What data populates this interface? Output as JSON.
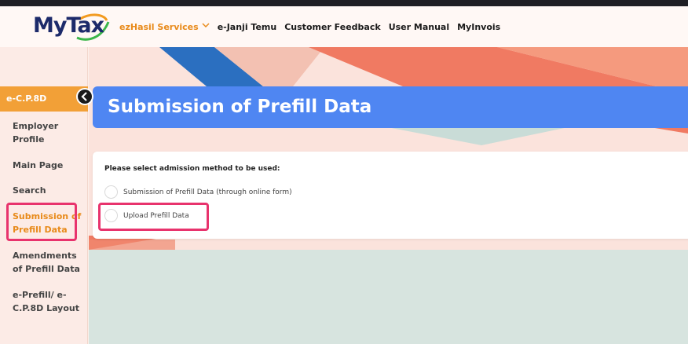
{
  "logo": {
    "my": "My",
    "tax": "Tax"
  },
  "nav": {
    "items": [
      {
        "label": "ezHasil Services",
        "active": true
      },
      {
        "label": "e-Janji Temu"
      },
      {
        "label": "Customer Feedback"
      },
      {
        "label": "User Manual"
      },
      {
        "label": "MyInvois"
      }
    ]
  },
  "sidebar": {
    "heading": "e-C.P.8D",
    "items": [
      {
        "label": "Employer Profile"
      },
      {
        "label": "Main Page"
      },
      {
        "label": "Search"
      },
      {
        "label": "Submission of Prefill Data",
        "active": true
      },
      {
        "label": "Amendments of Prefill Data"
      },
      {
        "label": "e-Prefill/ e-C.P.8D Layout"
      }
    ]
  },
  "page": {
    "title": "Submission of Prefill Data",
    "prompt": "Please select admission method to be used:",
    "options": [
      {
        "label": "Submission of Prefill Data (through online form)",
        "selected": false
      },
      {
        "label": "Upload Prefill Data",
        "selected": false
      }
    ]
  },
  "colors": {
    "accent": "#f2a037",
    "banner": "#4f86f2",
    "highlight": "#e8336d",
    "nav_active": "#e88a1a"
  },
  "icons": {
    "collapse": "chevron-left-icon",
    "dropdown": "chevron-down-icon"
  }
}
